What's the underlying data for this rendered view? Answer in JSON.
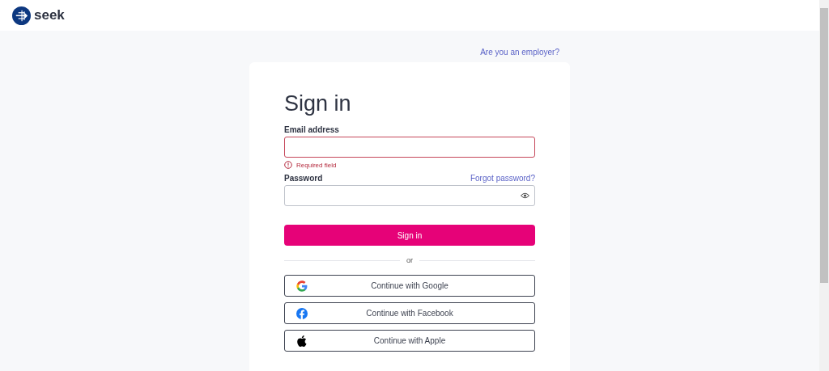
{
  "header": {
    "brand": "seek"
  },
  "employer_link": "Are you an employer?",
  "form": {
    "title": "Sign in",
    "email": {
      "label": "Email address",
      "error": true,
      "error_text": "Required field"
    },
    "password": {
      "label": "Password",
      "forgot_link": "Forgot password?"
    },
    "submit": "Sign in",
    "divider": "or",
    "social": [
      {
        "kind": "google",
        "label": "Continue with Google"
      },
      {
        "kind": "facebook",
        "label": "Continue with Facebook"
      },
      {
        "kind": "apple",
        "label": "Continue with Apple"
      }
    ]
  }
}
